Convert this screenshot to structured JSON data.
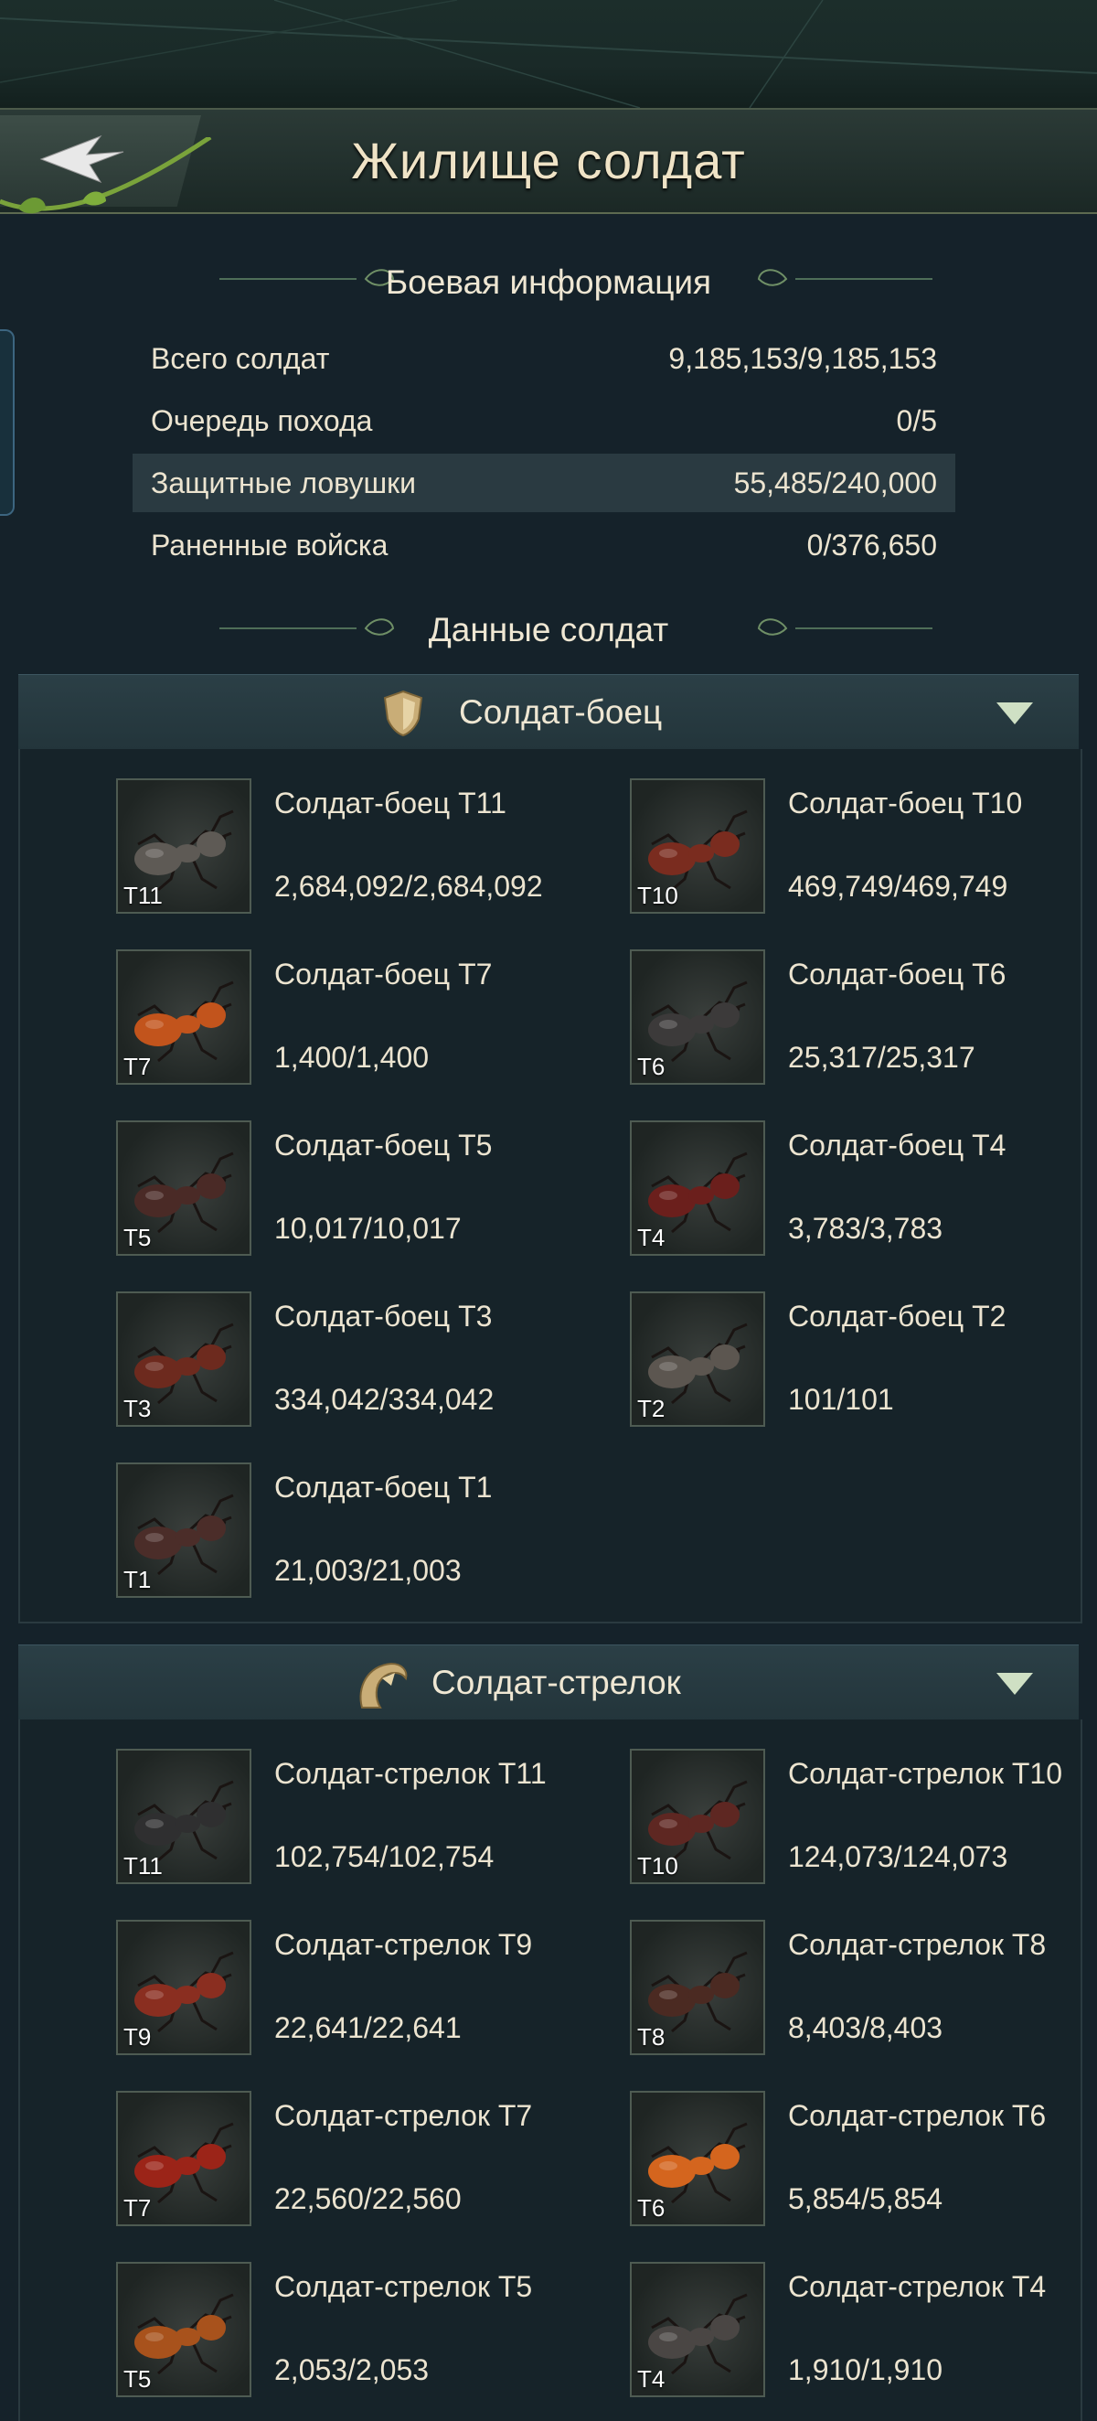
{
  "header": {
    "title": "Жилище солдат"
  },
  "battle_info": {
    "heading": "Боевая информация",
    "rows": [
      {
        "label": "Всего солдат",
        "value": "9,185,153/9,185,153"
      },
      {
        "label": "Очередь похода",
        "value": "0/5"
      },
      {
        "label": "Защитные ловушки",
        "value": "55,485/240,000"
      },
      {
        "label": "Раненные войска",
        "value": "0/376,650"
      }
    ]
  },
  "soldier_data": {
    "heading": "Данные солдат"
  },
  "groups": [
    {
      "title": "Солдат-боец",
      "icon": "shield-icon",
      "units": [
        {
          "name": "Солдат-боец T11",
          "tier": "T11",
          "count": "2,684,092/2,684,092",
          "color": "#5e5a55"
        },
        {
          "name": "Солдат-боец T10",
          "tier": "T10",
          "count": "469,749/469,749",
          "color": "#7a2c1f"
        },
        {
          "name": "Солдат-боец T7",
          "tier": "T7",
          "count": "1,400/1,400",
          "color": "#c2541c"
        },
        {
          "name": "Солдат-боец T6",
          "tier": "T6",
          "count": "25,317/25,317",
          "color": "#3c3a3a"
        },
        {
          "name": "Солдат-боец T5",
          "tier": "T5",
          "count": "10,017/10,017",
          "color": "#4a2a26"
        },
        {
          "name": "Солдат-боец T4",
          "tier": "T4",
          "count": "3,783/3,783",
          "color": "#6b1f1c"
        },
        {
          "name": "Солдат-боец T3",
          "tier": "T3",
          "count": "334,042/334,042",
          "color": "#6d2a1e"
        },
        {
          "name": "Солдат-боец T2",
          "tier": "T2",
          "count": "101/101",
          "color": "#5c5650"
        },
        {
          "name": "Солдат-боец T1",
          "tier": "T1",
          "count": "21,003/21,003",
          "color": "#4b2d29"
        }
      ]
    },
    {
      "title": "Солдат-стрелок",
      "icon": "horn-icon",
      "units": [
        {
          "name": "Солдат-стрелок T11",
          "tier": "T11",
          "count": "102,754/102,754",
          "color": "#2f2f30"
        },
        {
          "name": "Солдат-стрелок T10",
          "tier": "T10",
          "count": "124,073/124,073",
          "color": "#5e2722"
        },
        {
          "name": "Солдат-стрелок T9",
          "tier": "T9",
          "count": "22,641/22,641",
          "color": "#8a2e20"
        },
        {
          "name": "Солдат-стрелок T8",
          "tier": "T8",
          "count": "8,403/8,403",
          "color": "#4b2a22"
        },
        {
          "name": "Солдат-стрелок T7",
          "tier": "T7",
          "count": "22,560/22,560",
          "color": "#9b2418"
        },
        {
          "name": "Солдат-стрелок T6",
          "tier": "T6",
          "count": "5,854/5,854",
          "color": "#d4651e"
        },
        {
          "name": "Солдат-стрелок T5",
          "tier": "T5",
          "count": "2,053/2,053",
          "color": "#a8521c"
        },
        {
          "name": "Солдат-стрелок T4",
          "tier": "T4",
          "count": "1,910/1,910",
          "color": "#4a4644"
        }
      ]
    }
  ]
}
